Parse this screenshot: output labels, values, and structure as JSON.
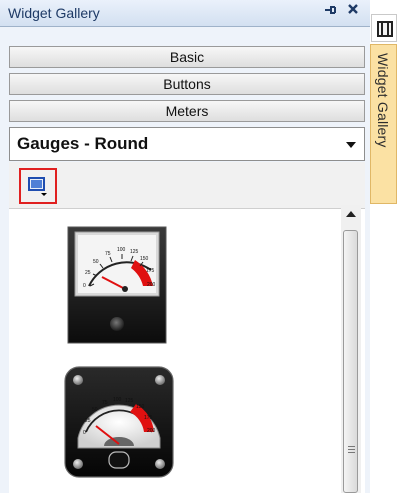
{
  "panel": {
    "title": "Widget Gallery",
    "pin_glyph": "†",
    "close_glyph": "✕"
  },
  "categories": [
    {
      "label": "Basic"
    },
    {
      "label": "Buttons"
    },
    {
      "label": "Meters"
    }
  ],
  "combo": {
    "selected": "Gauges - Round"
  },
  "toolbar": {
    "button_icon": "view-options-icon",
    "highlight_color": "#e02020"
  },
  "gauges": [
    {
      "name": "square-vu-meter",
      "ticks": [
        "0",
        "25",
        "50",
        "75",
        "100",
        "125",
        "150",
        "175",
        "200"
      ]
    },
    {
      "name": "round-vu-meter",
      "ticks": [
        "0",
        "25",
        "50",
        "75",
        "100",
        "125",
        "150",
        "175",
        "200"
      ]
    }
  ],
  "side_tab": {
    "label": "Widget Gallery",
    "icon": "tool-icon",
    "color": "#fbe1a3"
  }
}
